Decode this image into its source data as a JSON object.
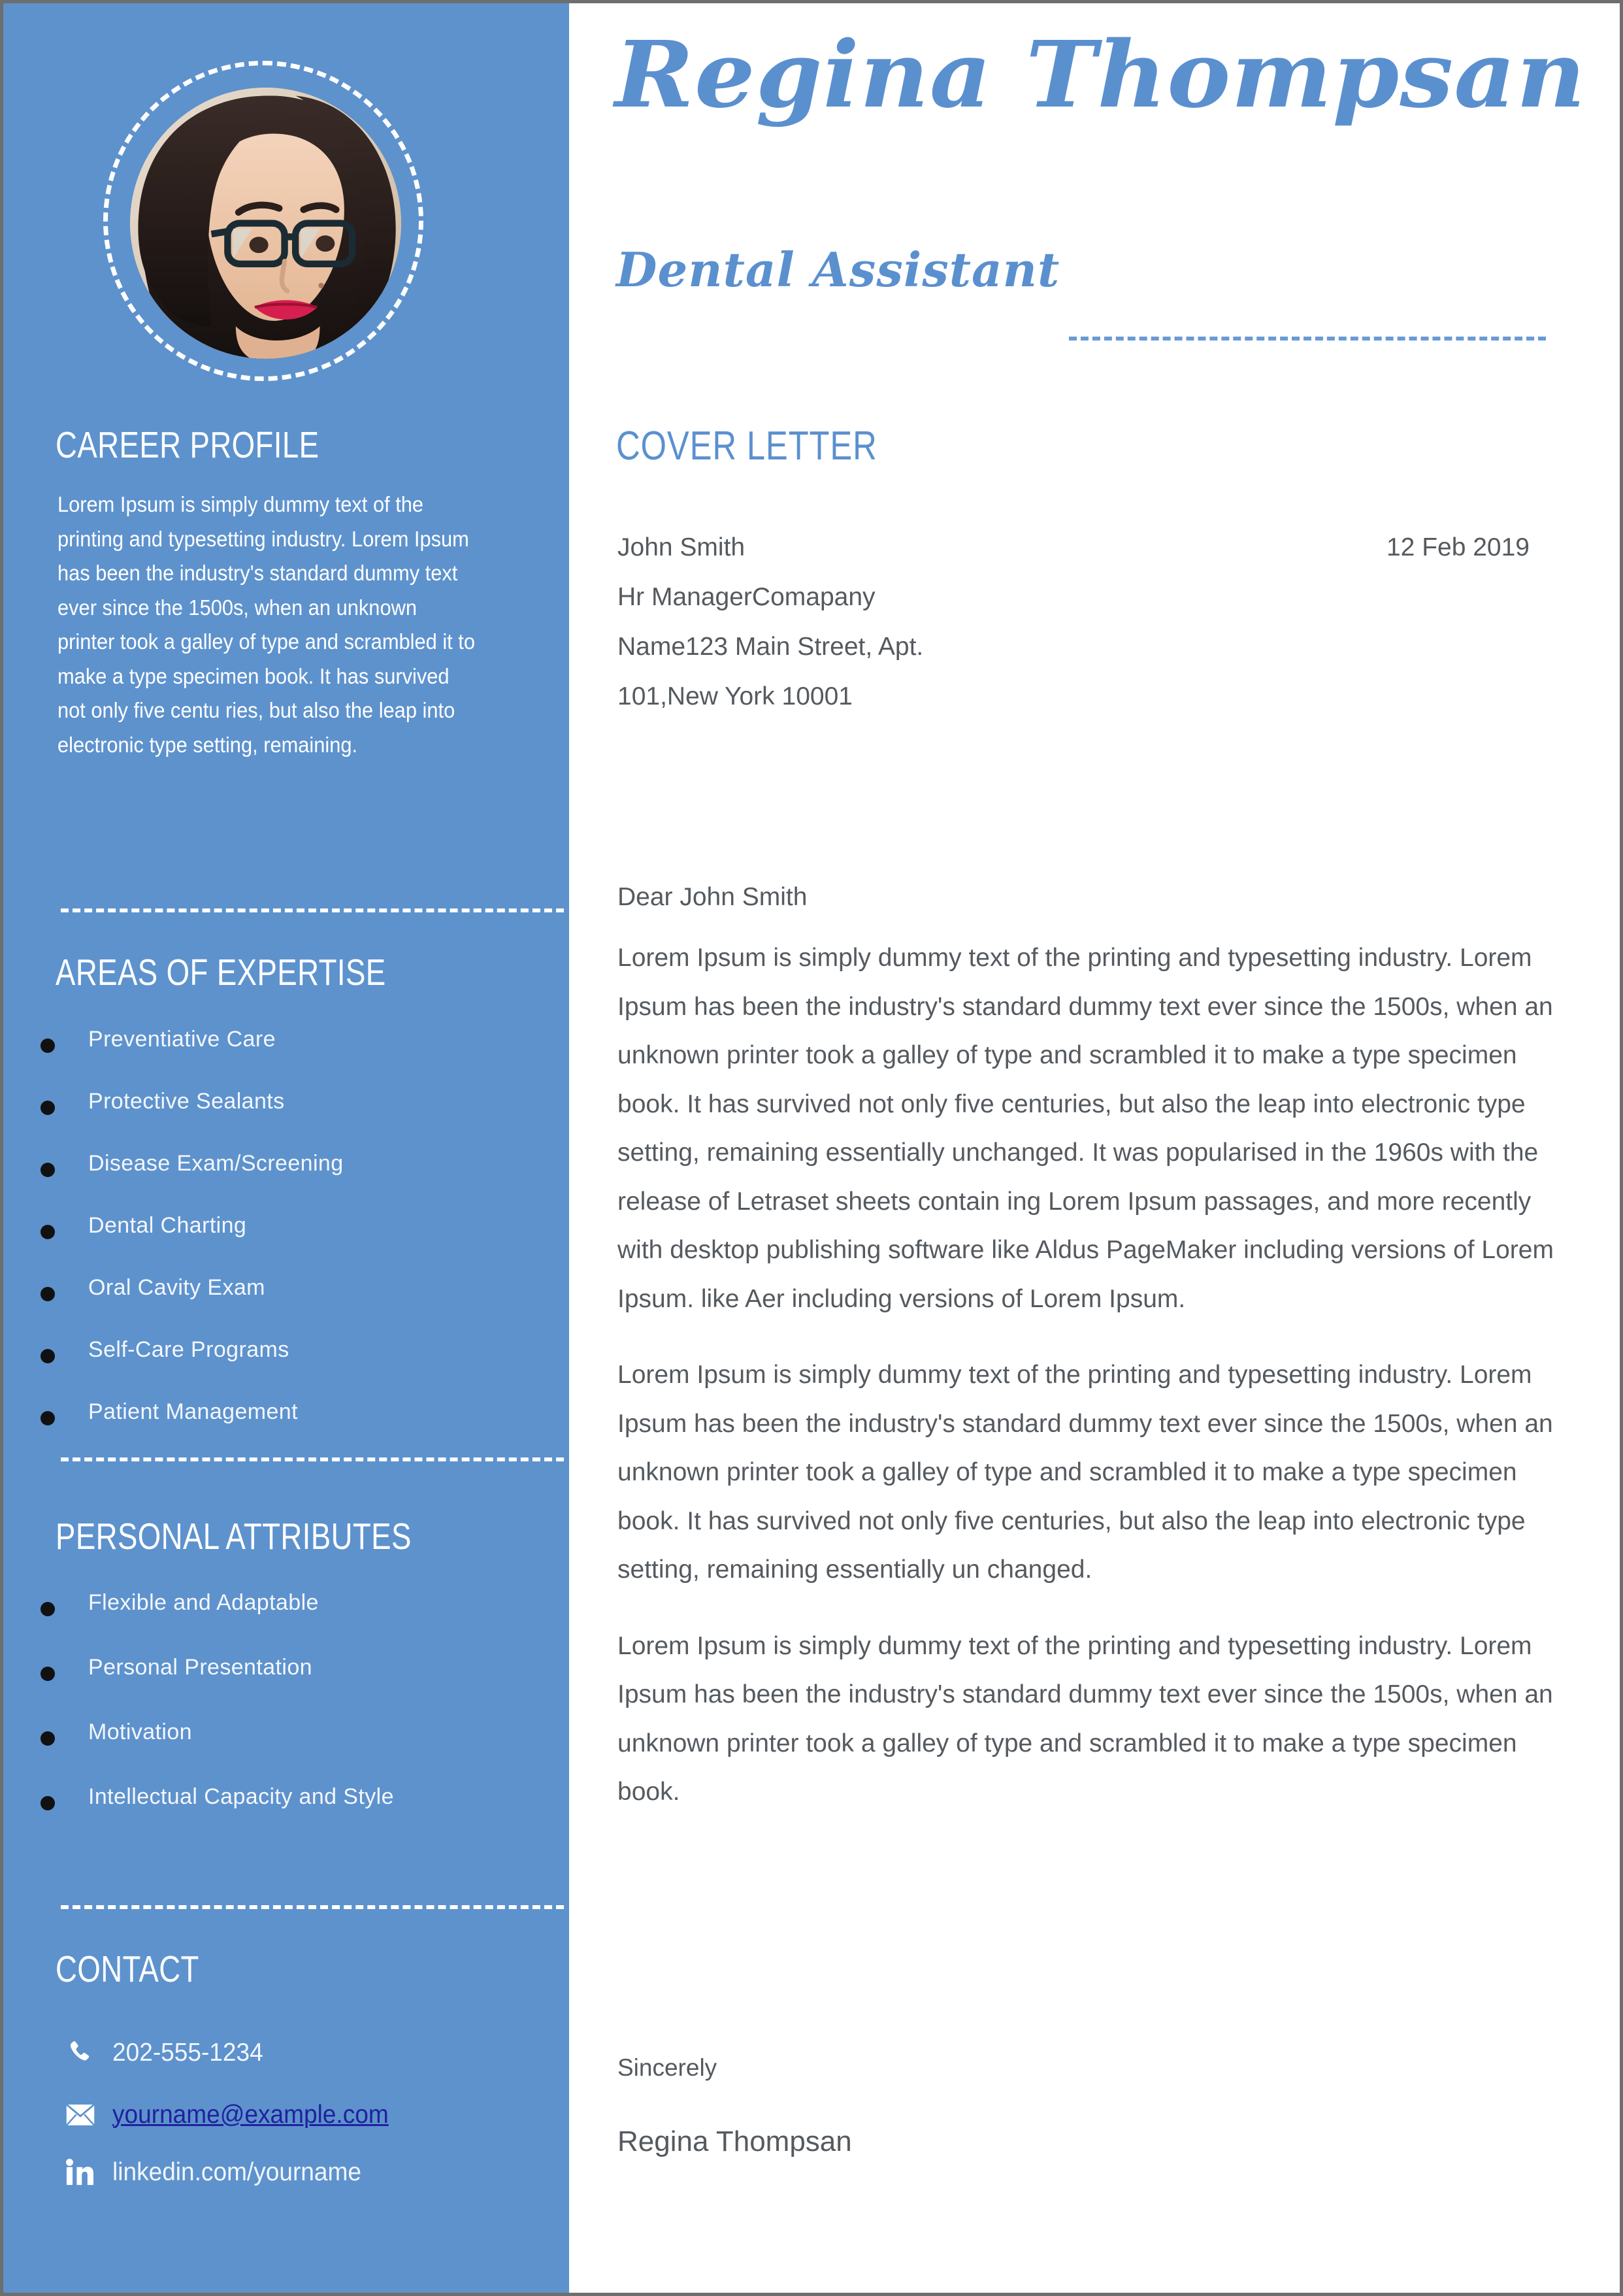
{
  "theme": {
    "sidebar_blue": "#5d92cd",
    "accent_blue": "#5b90cf",
    "body_gray": "#555a5f",
    "link_blue": "#21219e",
    "sidebar_text": "#ffffff"
  },
  "sidebar": {
    "photo_alt": "profile-photo",
    "career_profile": {
      "heading": "CAREER PROFILE",
      "text": "Lorem Ipsum is simply dummy text of the printing and typesetting industry. Lorem Ipsum has been the industry's standard dummy text ever since the 1500s, when an unknown printer took a galley of type and scrambled it to make a type specimen book. It has survived not only five centu ries, but also the leap into electronic type setting, remaining."
    },
    "areas_of_expertise": {
      "heading": "AREAS OF EXPERTISE",
      "items": [
        "Preventiative Care",
        "Protective Sealants",
        "Disease Exam/Screening",
        "Dental Charting",
        "Oral Cavity Exam",
        "Self-Care Programs",
        "Patient Management"
      ]
    },
    "personal_attributes": {
      "heading": "PERSONAL ATTRIBUTES",
      "items": [
        "Flexible and Adaptable",
        "Personal Presentation",
        "Motivation",
        "Intellectual Capacity and Style"
      ]
    },
    "contact": {
      "heading": "CONTACT",
      "phone": "202-555-1234",
      "email": "yourname@example.com",
      "linkedin": "linkedin.com/yourname",
      "icons": {
        "phone": "phone-icon",
        "email": "envelope-icon",
        "linkedin": "linkedin-icon"
      }
    }
  },
  "main": {
    "name": "Regina Thompsan",
    "role": "Dental Assistant",
    "section_title": "COVER LETTER",
    "recipient": [
      "John Smith",
      "Hr ManagerComapany",
      "Name123 Main Street, Apt.",
      "101,New York 10001"
    ],
    "date": "12 Feb 2019",
    "salutation": "Dear John Smith",
    "paragraphs": [
      "Lorem Ipsum is simply dummy text of the printing and typesetting industry. Lorem Ipsum has been the industry's standard dummy text ever since the 1500s, when an unknown printer took a galley of type and scrambled it to make a type specimen book. It has survived not only five centuries, but also the leap into electronic type setting, remaining essentially unchanged. It was popularised in the 1960s with the release of Letraset sheets contain ing Lorem Ipsum passages, and more recently with desktop publishing software like Aldus PageMaker including versions of Lorem Ipsum. like Aer including versions of Lorem Ipsum.",
      "Lorem Ipsum is simply dummy text of the printing and typesetting industry. Lorem Ipsum has been the industry's standard dummy text ever since the 1500s, when an unknown printer took a galley of type and scrambled it to make a type specimen book. It has survived not only five centuries, but also the leap into electronic type setting, remaining essentially un changed.",
      "Lorem Ipsum is simply dummy text of the printing and typesetting industry. Lorem Ipsum has been the industry's standard dummy text ever since the 1500s, when an unknown printer took a galley of type and scrambled it to make a type specimen book."
    ],
    "signoff": "Sincerely",
    "signature": "Regina Thompsan"
  }
}
